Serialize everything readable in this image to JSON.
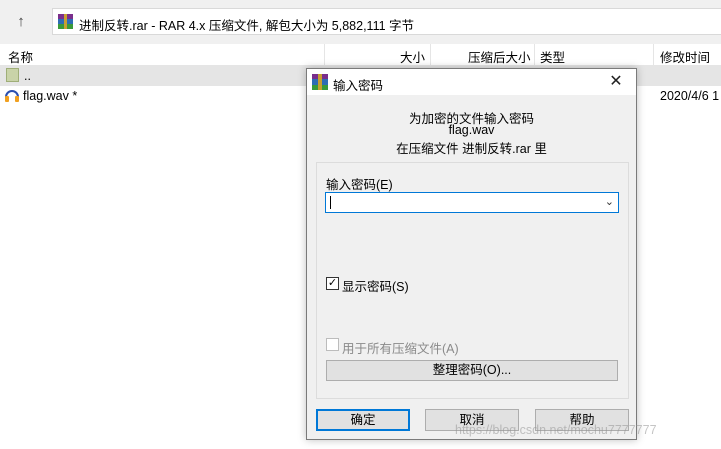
{
  "toolbar": {
    "up_icon": "arrow-up-icon",
    "address": "进制反转.rar - RAR 4.x 压缩文件, 解包大小为 5,882,111 字节"
  },
  "columns": {
    "name": "名称",
    "size": "大小",
    "packed": "压缩后大小",
    "type": "类型",
    "modified": "修改时间"
  },
  "files": [
    {
      "name": "..",
      "icon": "folder-up-icon",
      "modified": ""
    },
    {
      "name": "flag.wav *",
      "icon": "audio-file-icon",
      "modified": "2020/4/6 1"
    }
  ],
  "dialog": {
    "title": "输入密码",
    "info_line1": "为加密的文件输入密码",
    "info_line2": "flag.wav",
    "info_line3": "在压缩文件 进制反转.rar 里",
    "password_label": "输入密码(E)",
    "password_value": "",
    "show_password_label": "显示密码(S)",
    "show_password_checked": true,
    "use_all_label": "用于所有压缩文件(A)",
    "use_all_checked": false,
    "organize_label": "整理密码(O)...",
    "ok_label": "确定",
    "cancel_label": "取消",
    "help_label": "帮助"
  },
  "watermark": "https://blog.csdn.net/mochu7777777",
  "colors": {
    "accent": "#0078d7",
    "selected_row": "#e5e5e5",
    "dialog_bg": "#f0f0f0"
  }
}
